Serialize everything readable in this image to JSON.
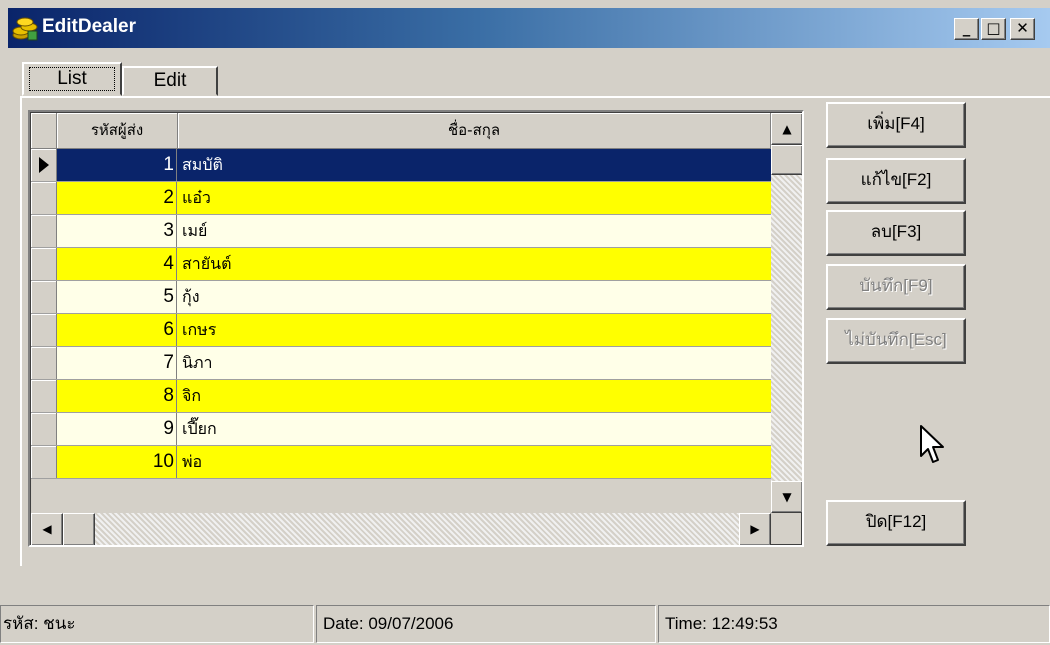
{
  "window": {
    "title": "EditDealer"
  },
  "tabs": [
    {
      "label": "List"
    },
    {
      "label": "Edit"
    }
  ],
  "grid": {
    "headers": [
      "รหัสผู้ส่ง",
      "ชื่อ-สกุล"
    ],
    "rows": [
      {
        "code": "1",
        "name": "สมบัติ"
      },
      {
        "code": "2",
        "name": "แอ๋ว"
      },
      {
        "code": "3",
        "name": "เมย์"
      },
      {
        "code": "4",
        "name": "สายันต์"
      },
      {
        "code": "5",
        "name": "กุ้ง"
      },
      {
        "code": "6",
        "name": "เกษร"
      },
      {
        "code": "7",
        "name": "นิภา"
      },
      {
        "code": "8",
        "name": "จิก"
      },
      {
        "code": "9",
        "name": "เปี๊ยก"
      },
      {
        "code": "10",
        "name": "พ่อ"
      }
    ]
  },
  "buttons": {
    "add": "เพิ่ม[F4]",
    "edit": "แก้ไข[F2]",
    "delete": "ลบ[F3]",
    "save": "บันทึก[F9]",
    "cancel": "ไม่บันทึก[Esc]",
    "close": "ปิด[F12]"
  },
  "statusbar": {
    "user": "รหัส: ชนะ",
    "date": "Date: 09/07/2006",
    "time": "Time: 12:49:53"
  },
  "colors": {
    "title_start": "#0a246a",
    "row_highlight": "#ffff00",
    "row_selected": "#0a246a",
    "row_alt": "#ffffe8"
  }
}
